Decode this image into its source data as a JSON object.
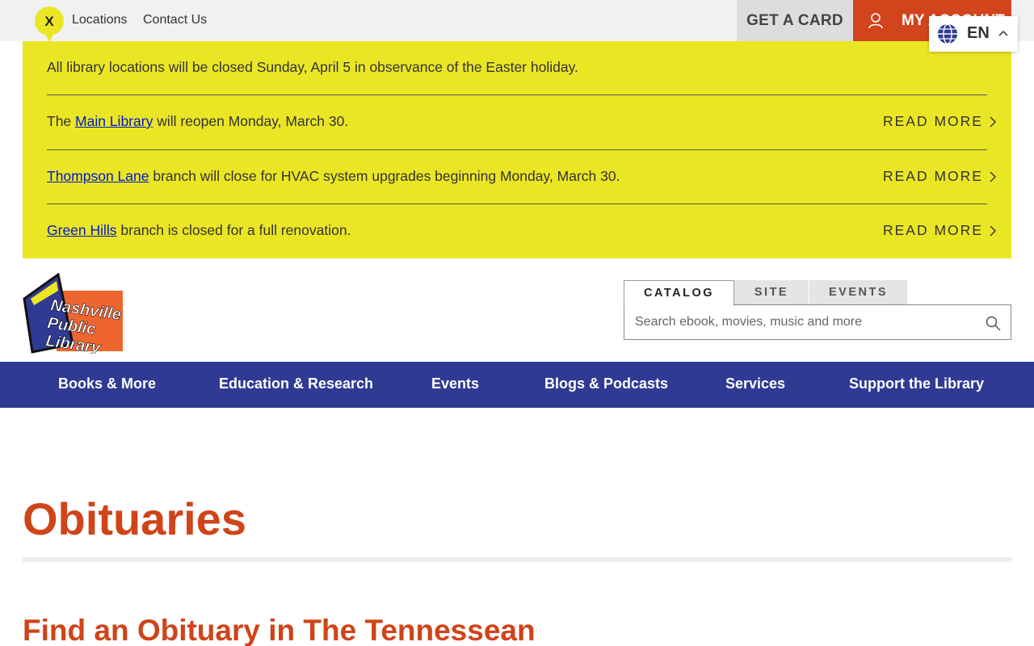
{
  "topbar": {
    "close_label": "X",
    "links": [
      "Locations",
      "Contact Us"
    ],
    "get_card": "GET A CARD",
    "my_account": "MY ACCOUNT"
  },
  "language": {
    "code": "EN"
  },
  "alerts": {
    "first": "All library locations will be closed Sunday, April 5 in observance of the Easter holiday.",
    "items": [
      {
        "pre": "The ",
        "link": "Main Library",
        "post": " will reopen Monday, March 30.",
        "action": "READ MORE"
      },
      {
        "pre": "",
        "link": "Thompson Lane",
        "post": " branch will close for HVAC system upgrades beginning Monday, March 30.",
        "action": "READ MORE"
      },
      {
        "pre": "",
        "link": "Green Hills",
        "post": " branch is closed for a full renovation.",
        "action": "READ MORE"
      }
    ]
  },
  "logo": {
    "lines": [
      "Nashville",
      "Public",
      "Library"
    ]
  },
  "search": {
    "tabs": [
      "CATALOG",
      "SITE",
      "EVENTS"
    ],
    "active_tab": "CATALOG",
    "placeholder": "Search ebook, movies, music and more"
  },
  "nav": [
    "Books & More",
    "Education & Research",
    "Events",
    "Blogs & Podcasts",
    "Services",
    "Support the Library"
  ],
  "content": {
    "title": "Obituaries",
    "subheading": "Find an Obituary in The Tennessean"
  },
  "colors": {
    "alert_yellow": "#ebe624",
    "brand_orange": "#d2441c",
    "nav_blue": "#2f3a92",
    "link_blue": "#0019c9"
  }
}
